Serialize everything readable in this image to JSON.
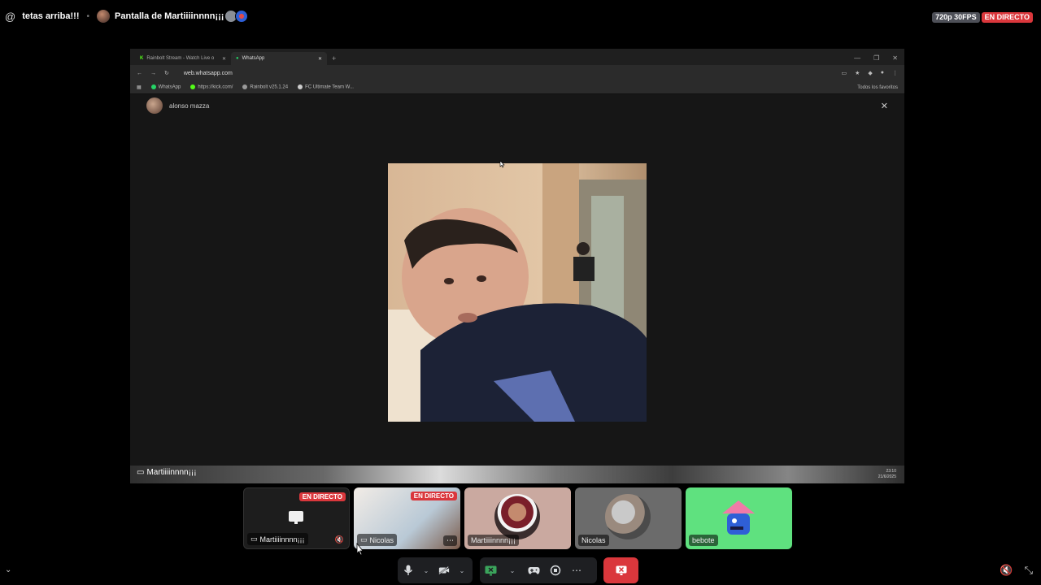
{
  "header": {
    "at_symbol": "@",
    "channel_name": "tetas arriba!!!",
    "separator": "•",
    "stream_title": "Pantalla de Martiiiinnnn¡¡¡",
    "quality_badge": "720p 30FPS",
    "live_badge": "EN DIRECTO"
  },
  "browser": {
    "tabs": [
      {
        "label": "Rainbolt Stream - Watch Live o",
        "active": false
      },
      {
        "label": "WhatsApp",
        "active": true
      }
    ],
    "new_tab": "+",
    "url": "web.whatsapp.com",
    "bookmarks": [
      "WhatsApp",
      "https://kick.com/",
      "Rainbolt v25.1.24",
      "FC Ultimate Team W..."
    ],
    "all_bookmarks": "Todos los favoritos",
    "contact_name": "alonso mazza",
    "close_symbol": "✕"
  },
  "shared_screen": {
    "sharer_label": "Martiiiinnnn¡¡¡",
    "clock_time": "23:10",
    "clock_date": "21/6/2025"
  },
  "participants": [
    {
      "name": "Martiiiinnnn¡¡¡",
      "live": "EN DIRECTO",
      "muted": true
    },
    {
      "name": "Nicolas",
      "live": "EN DIRECTO",
      "more": "⋯"
    },
    {
      "name": "Martiiiinnnn¡¡¡"
    },
    {
      "name": "Nicolas"
    },
    {
      "name": "bebote"
    }
  ],
  "colors": {
    "live_red": "#da373c",
    "bebote_green": "#5fe17f",
    "toolbar_bg": "#1e1f22"
  }
}
